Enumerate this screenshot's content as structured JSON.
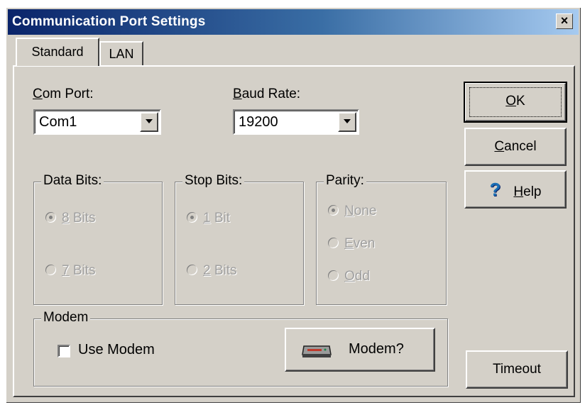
{
  "window": {
    "title": "Communication Port Settings",
    "close_label": "×"
  },
  "tabs": [
    {
      "label": "Standard"
    },
    {
      "label": "LAN"
    }
  ],
  "com_port": {
    "label_key": "C",
    "label_rest": "om Port:",
    "value": "Com1"
  },
  "baud_rate": {
    "label_key": "B",
    "label_rest": "aud Rate:",
    "value": "19200"
  },
  "data_bits": {
    "title": "Data Bits:",
    "options": [
      {
        "key": "8",
        "rest": " Bits",
        "selected": true
      },
      {
        "key": "7",
        "rest": " Bits",
        "selected": false
      }
    ]
  },
  "stop_bits": {
    "title": "Stop Bits:",
    "options": [
      {
        "key": "1",
        "rest": " Bit",
        "selected": true
      },
      {
        "key": "2",
        "rest": " Bits",
        "selected": false
      }
    ]
  },
  "parity": {
    "title": "Parity:",
    "options": [
      {
        "key": "N",
        "rest": "one",
        "selected": true
      },
      {
        "key": "E",
        "rest": "ven",
        "selected": false
      },
      {
        "key": "O",
        "rest": "dd",
        "selected": false
      }
    ]
  },
  "modem": {
    "title": "Modem",
    "use_modem_label": "Use Modem",
    "use_modem_checked": false,
    "modem_button_label": "Modem?"
  },
  "buttons": {
    "ok": {
      "key": "O",
      "rest": "K"
    },
    "cancel": {
      "key": "C",
      "rest": "ancel"
    },
    "help": {
      "key": "H",
      "rest": "elp",
      "icon_char": "?"
    },
    "timeout": "Timeout"
  },
  "colors": {
    "title_start": "#0a246a",
    "title_end": "#a6caf0",
    "face": "#d4d0c8",
    "help_icon": "#1a6fb5"
  }
}
